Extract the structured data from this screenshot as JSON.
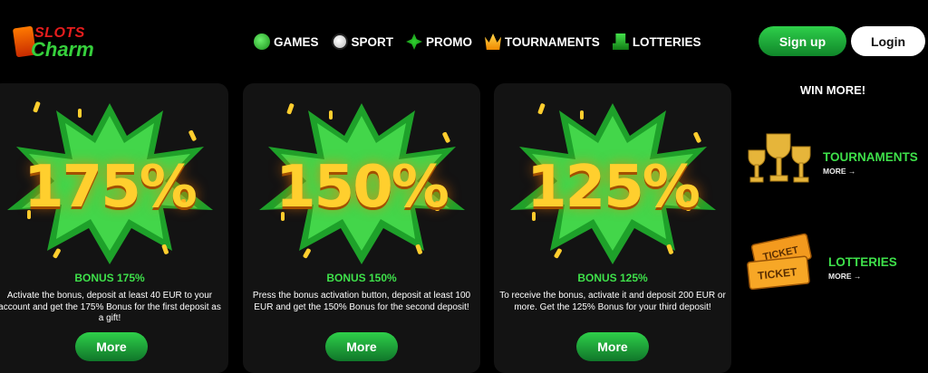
{
  "header": {
    "logo_line1": "SLOTS",
    "logo_line2": "Charm",
    "nav": [
      {
        "label": "GAMES",
        "icon": "games-icon"
      },
      {
        "label": "SPORT",
        "icon": "sport-icon"
      },
      {
        "label": "PROMO",
        "icon": "promo-icon"
      },
      {
        "label": "TOURNAMENTS",
        "icon": "tournaments-icon"
      },
      {
        "label": "LOTTERIES",
        "icon": "lotteries-icon"
      }
    ],
    "signup_label": "Sign up",
    "login_label": "Login"
  },
  "cards": [
    {
      "percent": "175%",
      "title": "BONUS 175%",
      "desc": "Activate the bonus, deposit at least 40 EUR to your account and get the 175% Bonus for the first deposit as a gift!",
      "button": "More"
    },
    {
      "percent": "150%",
      "title": "BONUS 150%",
      "desc": "Press the bonus activation button, deposit at least 100 EUR and get the 150% Bonus for the second deposit!",
      "button": "More"
    },
    {
      "percent": "125%",
      "title": "BONUS 125%",
      "desc": "To receive the bonus, activate it and deposit 200 EUR or more. Get the 125% Bonus for your third deposit!",
      "button": "More"
    }
  ],
  "sidebar": {
    "title": "WIN MORE!",
    "items": [
      {
        "label": "TOURNAMENTS",
        "more": "MORE →",
        "icon": "trophies-icon"
      },
      {
        "label": "LOTTERIES",
        "more": "MORE →",
        "icon": "tickets-icon",
        "ticket_text": "TICKET"
      }
    ]
  },
  "colors": {
    "accent_green": "#3ee04a",
    "gold": "#ffcf2e",
    "background": "#000000",
    "card_bg": "#131313"
  }
}
